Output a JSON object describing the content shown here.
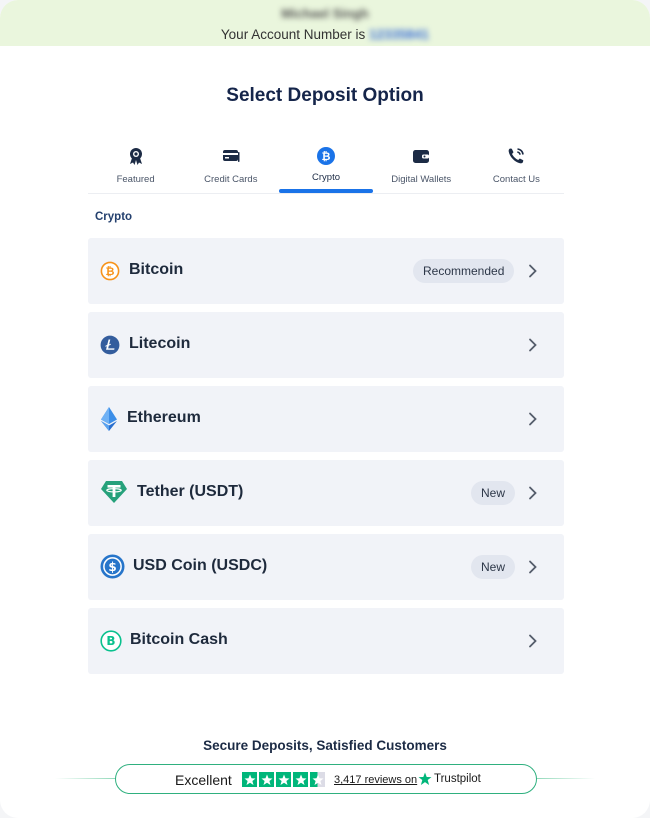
{
  "account": {
    "name": "Michael Singh",
    "number_prefix": "Your Account Number is",
    "number": "12335841"
  },
  "page": {
    "title": "Select Deposit Option"
  },
  "tabs": [
    {
      "label": "Featured",
      "icon": "award-icon"
    },
    {
      "label": "Credit Cards",
      "icon": "credit-card-icon"
    },
    {
      "label": "Crypto",
      "icon": "bitcoin-icon",
      "active": true
    },
    {
      "label": "Digital Wallets",
      "icon": "wallet-icon"
    },
    {
      "label": "Contact Us",
      "icon": "phone-icon"
    }
  ],
  "section": {
    "label": "Crypto"
  },
  "options": [
    {
      "name": "Bitcoin",
      "badge": "Recommended",
      "icon": "bitcoin-icon",
      "color": "#f7931a"
    },
    {
      "name": "Litecoin",
      "badge": "",
      "icon": "litecoin-icon",
      "color": "#345d9d"
    },
    {
      "name": "Ethereum",
      "badge": "",
      "icon": "ethereum-icon",
      "color": "#3c8ee8"
    },
    {
      "name": "Tether (USDT)",
      "badge": "New",
      "icon": "tether-icon",
      "color": "#26a17b"
    },
    {
      "name": "USD Coin (USDC)",
      "badge": "New",
      "icon": "usd-coin-icon",
      "color": "#2775ca"
    },
    {
      "name": "Bitcoin Cash",
      "badge": "",
      "icon": "bitcoin-cash-icon",
      "color": "#0ac18e"
    }
  ],
  "footer": {
    "secure_text": "Secure Deposits, Satisfied Customers",
    "rating_word": "Excellent",
    "stars": 4.5,
    "reviews_text": "3,417 reviews on",
    "brand": "Trustpilot"
  },
  "colors": {
    "accent": "#1a73e8",
    "trustpilot_green": "#00b67a",
    "account_bar": "#eaf6dd"
  }
}
